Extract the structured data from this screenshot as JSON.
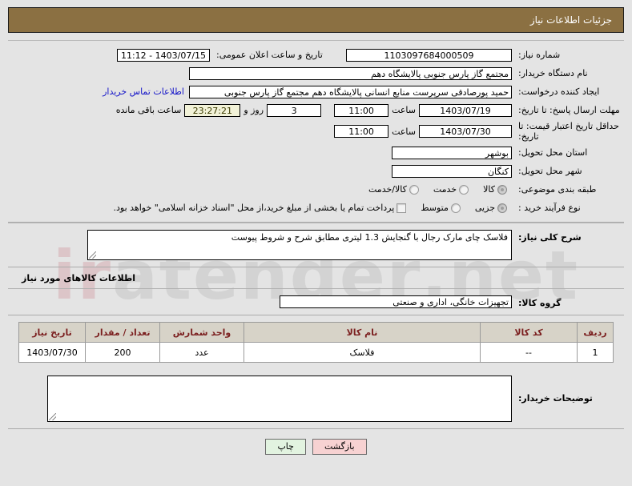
{
  "header": {
    "title": "جزئیات اطلاعات نیاز"
  },
  "fields": {
    "need_number": {
      "label": "شماره نیاز:",
      "value": "1103097684000509"
    },
    "public_announce": {
      "label": "تاریخ و ساعت اعلان عمومی:",
      "value": "11:12 - 1403/07/15"
    },
    "buyer_org": {
      "label": "نام دستگاه خریدار:",
      "value": "مجتمع گاز پارس جنوبی  پالایشگاه دهم"
    },
    "requester": {
      "label": "ایجاد کننده درخواست:",
      "value": "حمید پورصادقی سرپرست منابع انسانی پالایشگاه دهم  مجتمع گاز پارس جنوبی"
    },
    "contact_link": {
      "label": "اطلاعات تماس خریدار"
    },
    "reply_deadline": {
      "label": "مهلت ارسال پاسخ: تا تاریخ:",
      "date": "1403/07/19",
      "time_label": "ساعت",
      "time": "11:00",
      "days": "3",
      "days_label": "روز و",
      "countdown": "23:27:21",
      "remaining_label": "ساعت باقی مانده"
    },
    "price_validity": {
      "label": "حداقل تاریخ اعتبار قیمت: تا تاریخ:",
      "date": "1403/07/30",
      "time_label": "ساعت",
      "time": "11:00"
    },
    "province": {
      "label": "استان محل تحویل:",
      "value": "بوشهر"
    },
    "city": {
      "label": "شهر محل تحویل:",
      "value": "کنگان"
    },
    "subject_category": {
      "label": "طبقه بندی موضوعی:",
      "options": [
        {
          "label": "کالا",
          "selected": true
        },
        {
          "label": "خدمت",
          "selected": false
        },
        {
          "label": "کالا/خدمت",
          "selected": false
        }
      ]
    },
    "purchase_process": {
      "label": "نوع فرآیند خرید :",
      "options": [
        {
          "label": "جزیی",
          "selected": true
        },
        {
          "label": "متوسط",
          "selected": false
        }
      ],
      "checkbox_label": "پرداخت تمام یا بخشی از مبلغ خرید،از محل \"اسناد خزانه اسلامی\" خواهد بود.",
      "checkbox_checked": false
    },
    "general_description": {
      "label": "شرح کلی نیاز:",
      "value": "فلاسک چای مارک رجال با گنجایش 1.3 لیتری  مطابق شرح و شروط پیوست"
    },
    "goods_section_title": "اطلاعات کالاهای مورد نیاز",
    "goods_group": {
      "label": "گروه کالا:",
      "value": "تجهیزات خانگی، اداری و صنعتی"
    },
    "buyer_notes": {
      "label": "توضیحات خریدار:",
      "value": ""
    }
  },
  "table": {
    "columns": [
      "ردیف",
      "کد کالا",
      "نام کالا",
      "واحد شمارش",
      "تعداد / مقدار",
      "تاریخ نیاز"
    ],
    "rows": [
      {
        "index": "1",
        "code": "--",
        "name": "فلاسک",
        "unit": "عدد",
        "qty": "200",
        "date": "1403/07/30"
      }
    ]
  },
  "buttons": {
    "back": "بازگشت",
    "print": "چاپ"
  },
  "watermark": {
    "text_left": "ir",
    "text_mid": "atender",
    "text_right": ".net"
  }
}
